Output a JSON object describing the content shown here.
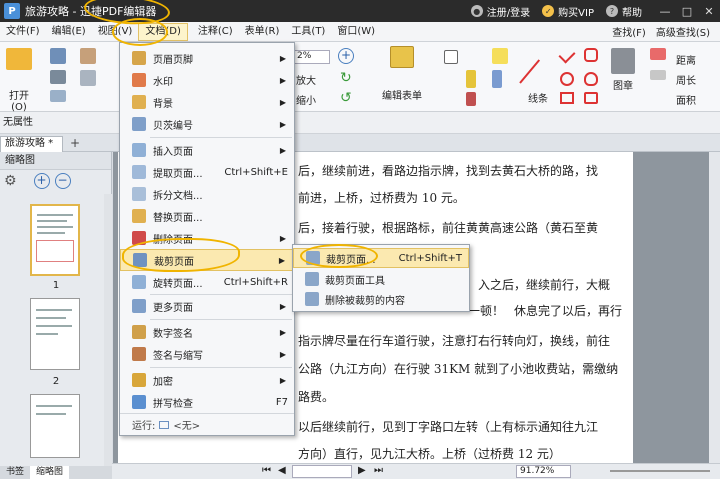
{
  "titlebar": {
    "title": "旅游攻略 - 迅捷PDF编辑器",
    "register_login": "注册/登录",
    "buy_vip": "购买VIP",
    "help": "帮助"
  },
  "menubar": {
    "items": [
      "文件(F)",
      "编辑(E)",
      "视图(V)",
      "文档(D)",
      "注释(C)",
      "表单(R)",
      "工具(T)",
      "窗口(W)"
    ],
    "right_find": "查找(F)",
    "right_adv": "高级查找(S)"
  },
  "ribbon": {
    "open": "打开(O)",
    "zoom_pct": "2%",
    "enlarge": "放大",
    "shrink": "缩小",
    "edit_form": "编辑表单",
    "line": "线条",
    "stamp": "图章",
    "distance": "距离",
    "perimeter": "周长",
    "area": "面积"
  },
  "propbar": {
    "label": "无属性"
  },
  "doc_tab": {
    "label": "旅游攻略 *",
    "close": "×",
    "add": "+"
  },
  "thumbs": {
    "header": "缩略图",
    "page1": "1",
    "page2": "2"
  },
  "bottom_tabs": {
    "bookmarks": "书签",
    "thumbnails": "缩略图"
  },
  "document": {
    "lines": [
      "后，继续前进，看路边指示牌，找到去黄石大桥的路，找",
      "前进，上桥，过桥费为 10 元。",
      "后，接着行驶，根据路标，前往黄黄高速公路（黄石至黄",
      "入之后，继续前行，大概",
      "休息完了以后，再行",
      "指示牌尽量在行车道行驶，注意打右行转向灯，换线，前往",
      "公路（九江方向）在行驶 31KM 就到了小池收费站，需缴纳",
      "路费。",
      "以后继续前行，见到丁字路口左转（上有标示通知往九江",
      "方向）直行，见九江大桥。上桥（过桥费 12 元）"
    ],
    "partial_line": "到了",
    "partial_line2": "一顿！"
  },
  "statusbar": {
    "zoom": "91.72%"
  },
  "document_menu": {
    "items": [
      {
        "label": "页眉页脚",
        "arrow": "▶"
      },
      {
        "label": "水印",
        "arrow": "▶"
      },
      {
        "label": "背景",
        "arrow": "▶"
      },
      {
        "label": "贝茨编号",
        "arrow": "▶"
      },
      {
        "label": "插入页面",
        "arrow": "▶"
      },
      {
        "label": "提取页面...",
        "shortcut": "Ctrl+Shift+E"
      },
      {
        "label": "拆分文档..."
      },
      {
        "label": "替换页面..."
      },
      {
        "label": "删除页面",
        "arrow": "▶"
      },
      {
        "label": "裁剪页面",
        "arrow": "▶"
      },
      {
        "label": "旋转页面...",
        "shortcut": "Ctrl+Shift+R"
      },
      {
        "label": "更多页面",
        "arrow": "▶"
      },
      {
        "label": "数字签名",
        "arrow": "▶"
      },
      {
        "label": "签名与缩写",
        "arrow": "▶"
      },
      {
        "label": "加密",
        "arrow": "▶"
      },
      {
        "label": "拼写检查",
        "shortcut": "F7"
      }
    ],
    "footer_run": "运行:",
    "footer_none": "<无>"
  },
  "crop_submenu": {
    "items": [
      {
        "label": "裁剪页面...",
        "shortcut": "Ctrl+Shift+T"
      },
      {
        "label": "裁剪页面工具"
      },
      {
        "label": "删除被裁剪的内容"
      }
    ]
  },
  "colors": {
    "titlebar": "#2b2b2b",
    "highlight": "#fbe9b0",
    "annotation": "#f0b400",
    "shape_red": "#dd3333"
  }
}
